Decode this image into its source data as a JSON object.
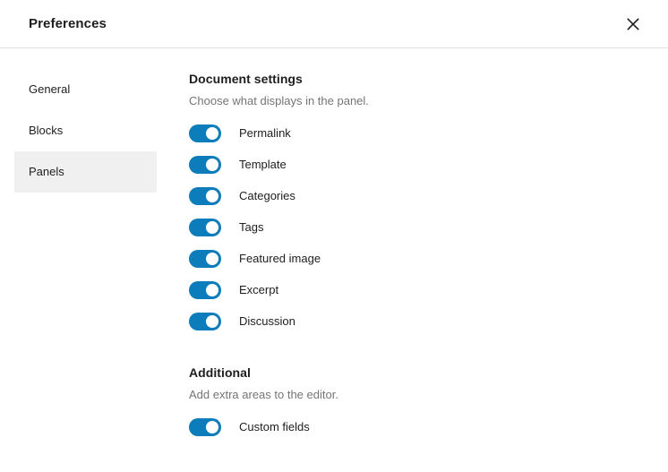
{
  "modal": {
    "title": "Preferences",
    "close_icon": "close-icon",
    "close_label": "Close"
  },
  "sidebar": {
    "items": [
      {
        "label": "General",
        "active": false
      },
      {
        "label": "Blocks",
        "active": false
      },
      {
        "label": "Panels",
        "active": true
      }
    ]
  },
  "sections": [
    {
      "title": "Document settings",
      "help": "Choose what displays in the panel.",
      "toggles": [
        {
          "label": "Permalink",
          "on": true
        },
        {
          "label": "Template",
          "on": true
        },
        {
          "label": "Categories",
          "on": true
        },
        {
          "label": "Tags",
          "on": true
        },
        {
          "label": "Featured image",
          "on": true
        },
        {
          "label": "Excerpt",
          "on": true
        },
        {
          "label": "Discussion",
          "on": true
        }
      ]
    },
    {
      "title": "Additional",
      "help": "Add extra areas to the editor.",
      "toggles": [
        {
          "label": "Custom fields",
          "on": true
        }
      ]
    }
  ],
  "colors": {
    "accent": "#0c7cba",
    "toggle_knob": "#ffffff",
    "active_nav_background": "#f0f0f0",
    "text_primary": "#1e1e1e",
    "text_secondary": "#757575",
    "border": "#e0e0e0"
  }
}
